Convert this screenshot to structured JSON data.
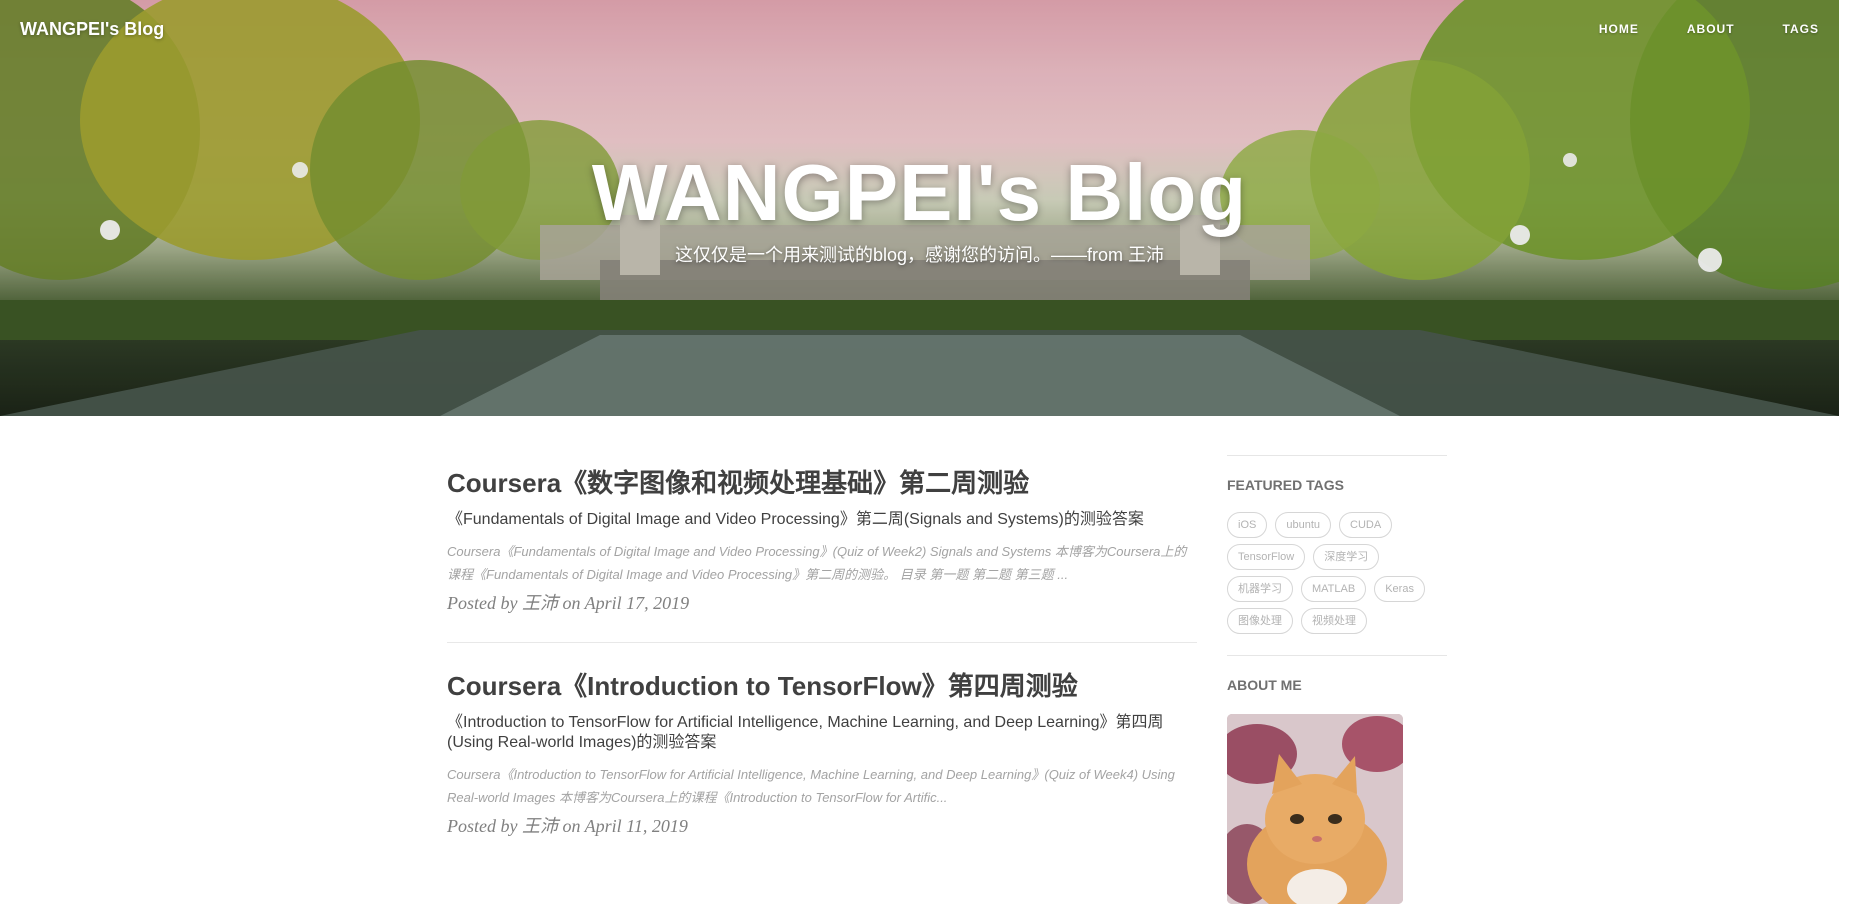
{
  "navbar": {
    "brand": "WANGPEI's Blog",
    "links": [
      "HOME",
      "ABOUT",
      "TAGS"
    ]
  },
  "header": {
    "title": "WANGPEI's Blog",
    "subtitle": "这仅仅是一个用来测试的blog，感谢您的访问。——from 王沛"
  },
  "posts": [
    {
      "title": "Coursera《数字图像和视频处理基础》第二周测验",
      "subtitle": "《Fundamentals of Digital Image and Video Processing》第二周(Signals and Systems)的测验答案",
      "excerpt": "Coursera《Fundamentals of Digital Image and Video Processing》(Quiz of Week2) Signals and Systems 本博客为Coursera上的课程《Fundamentals of Digital Image and Video Processing》第二周的测验。 目录 第一题 第二题 第三题 ...",
      "posted_by": "Posted by",
      "author": "王沛",
      "on": "on",
      "date": "April 17, 2019"
    },
    {
      "title": "Coursera《Introduction to TensorFlow》第四周测验",
      "subtitle": "《Introduction to TensorFlow for Artificial Intelligence, Machine Learning, and Deep Learning》第四周(Using Real-world Images)的测验答案",
      "excerpt": "Coursera《Introduction to TensorFlow for Artificial Intelligence, Machine Learning, and Deep Learning》(Quiz of Week4) Using Real-world Images 本博客为Coursera上的课程《Introduction to TensorFlow for Artific...",
      "posted_by": "Posted by",
      "author": "王沛",
      "on": "on",
      "date": "April 11, 2019"
    }
  ],
  "sidebar": {
    "featured_tags_heading": "FEATURED TAGS",
    "tags": [
      "iOS",
      "ubuntu",
      "CUDA",
      "TensorFlow",
      "深度学习",
      "机器学习",
      "MATLAB",
      "Keras",
      "图像处理",
      "视频处理"
    ],
    "about_heading": "ABOUT ME"
  },
  "colors": {
    "text": "#404040",
    "muted": "#a3a3a3",
    "meta": "#808080",
    "hero_sky": "#efc1c9"
  }
}
